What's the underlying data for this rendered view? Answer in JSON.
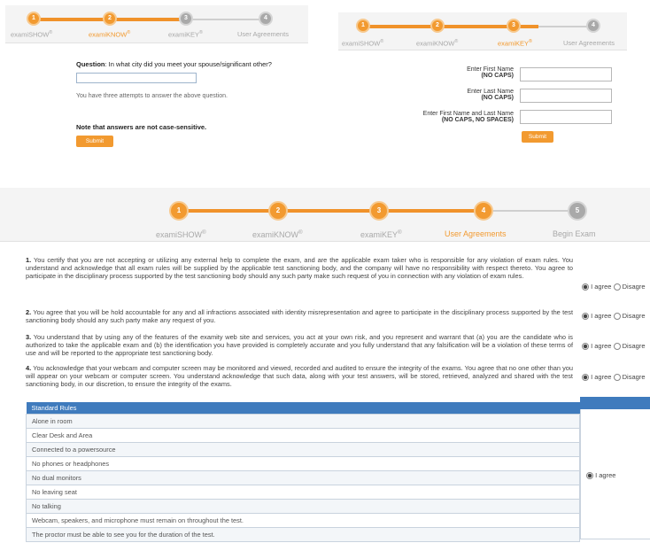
{
  "panel1": {
    "steps": [
      {
        "num": "1",
        "label": "examiSHOW",
        "mark": "®"
      },
      {
        "num": "2",
        "label": "examiKNOW",
        "mark": "®"
      },
      {
        "num": "3",
        "label": "examiKEY",
        "mark": "®"
      },
      {
        "num": "4",
        "label": "User Agreements",
        "mark": ""
      }
    ],
    "question_label": "Question",
    "question_text": ": In what city did you meet your spouse/significant other?",
    "answer_value": "",
    "attempts_note": "You have three attempts to answer the above question.",
    "case_note": "Note that answers are not case-sensitive.",
    "submit_label": "Submit"
  },
  "panel2": {
    "steps": [
      {
        "num": "1",
        "label": "examiSHOW",
        "mark": "®"
      },
      {
        "num": "2",
        "label": "examiKNOW",
        "mark": "®"
      },
      {
        "num": "3",
        "label": "examiKEY",
        "mark": "®"
      },
      {
        "num": "4",
        "label": "User Agreements",
        "mark": ""
      }
    ],
    "fields": [
      {
        "label": "Enter First Name",
        "hint": "(NO CAPS)",
        "value": ""
      },
      {
        "label": "Enter Last Name",
        "hint": "(NO CAPS)",
        "value": ""
      },
      {
        "label": "Enter First Name and Last Name",
        "hint": "(NO CAPS, NO SPACES)",
        "value": ""
      }
    ],
    "submit_label": "Submit"
  },
  "panel3": {
    "steps": [
      {
        "num": "1",
        "label": "examiSHOW",
        "mark": "®"
      },
      {
        "num": "2",
        "label": "examiKNOW",
        "mark": "®"
      },
      {
        "num": "3",
        "label": "examiKEY",
        "mark": "®"
      },
      {
        "num": "4",
        "label": "User Agreements",
        "mark": ""
      },
      {
        "num": "5",
        "label": "Begin Exam",
        "mark": ""
      }
    ],
    "agreements": [
      {
        "num": "1.",
        "text": "You certify that you are not accepting or utilizing any external help to complete the exam, and are the applicable exam taker who is responsible for any violation of exam rules. You understand and acknowledge that all exam rules will be supplied by the applicable test sanctioning body, and the company will have no responsibility with respect thereto. You agree to participate in the disciplinary process supported by the test sanctioning body should any such party make such request of you in connection with any violation of exam rules."
      },
      {
        "num": "2.",
        "text": "You agree that you will be hold accountable for any and all infractions associated with identity misrepresentation and agree to participate in the disciplinary process supported by the test sanctioning body should any such party make any request of you."
      },
      {
        "num": "3.",
        "text": "You understand that by using any of the features of the examity web site and services, you act at your own risk, and you represent and warrant that (a) you are the candidate who is authorized to take the applicable exam and (b) the identification you have provided is completely accurate and you fully understand that any falsification will be a violation of these terms of use and will be reported to the appropriate test sanctioning body."
      },
      {
        "num": "4.",
        "text": "You acknowledge that your webcam and computer screen may be monitored and viewed, recorded and audited to ensure the integrity of the exams. You agree that no one other than you will appear on your webcam or computer screen. You understand acknowledge that such data, along with your test answers, will be stored, retrieved, analyzed and shared with the test sanctioning body, in our discretion, to ensure the integrity of the exams."
      }
    ],
    "agree_label": "I agree",
    "disagree_label": "Disagre",
    "rules_header": "Standard Rules",
    "rules": [
      "Alone in room",
      "Clear Desk and Area",
      "Connected to a powersource",
      "No phones or headphones",
      "No dual monitors",
      "No leaving seat",
      "No talking",
      "Webcam, speakers, and microphone must remain on throughout the test.",
      "The proctor must be able to see you for the duration of the test."
    ]
  }
}
